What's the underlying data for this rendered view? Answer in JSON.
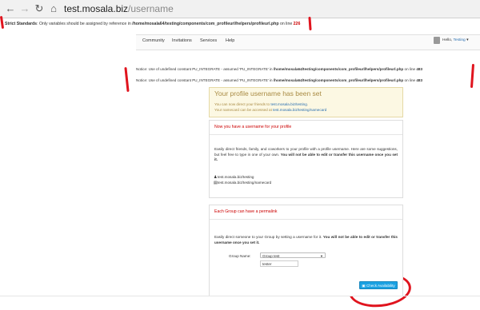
{
  "browser": {
    "back_icon": "back-arrow-icon",
    "forward_icon": "forward-arrow-icon",
    "reload_icon": "reload-icon",
    "home_icon": "home-icon",
    "url_host": "test.mosala.biz",
    "url_path": "/username"
  },
  "strict_standards": {
    "label": "Strict Standards",
    "message": ": Only variables should be assigned by reference in ",
    "path": "/home/mosala64/testing/components/com_profileurl/helpers/profileurl.php",
    "on_line": " on line ",
    "line": "226"
  },
  "site_nav": {
    "items": [
      "Community",
      "Invitations",
      "Services",
      "Help"
    ],
    "hello_prefix": "Hello, ",
    "username": "Testing",
    "avatar_icon": "avatar-icon",
    "dropdown_icon": "chevron-down-icon"
  },
  "notices": [
    {
      "label": "Notice",
      "message": ": Use of undefined constant PU_INTEGRATE - assumed 'PU_INTEGRATE' in ",
      "path": "/home/mosala64/testing/components/com_profileurl/helpers/profileurl.php",
      "on_line": " on line ",
      "line": "483"
    },
    {
      "label": "Notice",
      "message": ": Use of undefined constant PU_INTEGRATE - assumed 'PU_INTEGRATE' in ",
      "path": "/home/mosala64/testing/components/com_profileurl/helpers/profileurl.php",
      "on_line": " on line ",
      "line": "483"
    }
  ],
  "success": {
    "title": "Your profile username has been set",
    "line1_prefix": "You can now direct your friends to ",
    "line1_link": "test.mosala.biz/testing",
    "line1_suffix": ".",
    "line2_prefix": "Your namecard can be accessed at ",
    "line2_link": "test.mosala.biz/testing/namecard"
  },
  "profile_panel": {
    "heading": "Now you have a username for your profile",
    "desc_normal": "Easily direct friends, family, and coworkers to your profile with a profile username. Here are some suggestions, but feel free to type in one of your own. ",
    "desc_bold": "You will not be able to edit or transfer this username once you set it.",
    "url1": "test.mosala.biz/testing",
    "url2": "test.mosala.biz/testing/namecard",
    "url1_icon": "user-icon",
    "url2_icon": "namecard-icon"
  },
  "group_panel": {
    "heading": "Each Group can have a permalink",
    "desc_normal": "Easily direct someone to your Group by setting a username for it. ",
    "desc_bold": "You will not be able to edit or transfer this username once you set it.",
    "group_name_label": "Group Name:",
    "group_select_value": "Group test",
    "username_value": "tester",
    "check_button": "Check Availability",
    "check_icon": "check-availability-icon"
  },
  "colors": {
    "annotation_red": "#e0141e",
    "accent_blue": "#1ba1e2",
    "warning_bg": "#fcf8e3",
    "heading_red": "#cc0000"
  }
}
